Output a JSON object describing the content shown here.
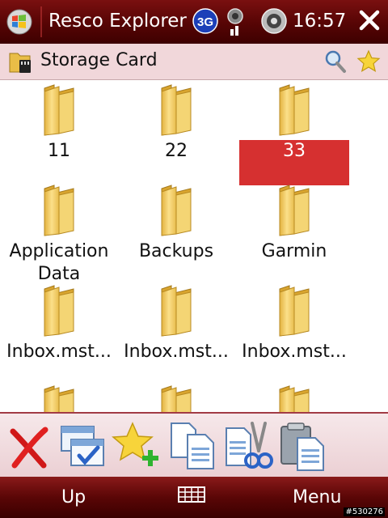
{
  "titlebar": {
    "app_title": "Resco Explorer",
    "network_badge": "3G",
    "time": "16:57",
    "icons": [
      "windows-logo-icon",
      "3g-icon",
      "signal-icon",
      "volume-icon",
      "close-icon"
    ]
  },
  "pathbar": {
    "path": "Storage Card"
  },
  "items": [
    {
      "label": "11",
      "selected": false
    },
    {
      "label": "22",
      "selected": false
    },
    {
      "label": "33",
      "selected": true
    },
    {
      "label": "Application Data",
      "line1": "Application",
      "line2": "Data",
      "selected": false
    },
    {
      "label": "Backups",
      "selected": false
    },
    {
      "label": "Garmin",
      "selected": false
    },
    {
      "label": "Inbox.mst...",
      "selected": false
    },
    {
      "label": "Inbox.mst...",
      "selected": false
    },
    {
      "label": "Inbox.mst...",
      "selected": false
    }
  ],
  "toolbar": {
    "buttons": [
      "delete-icon",
      "multi-select-icon",
      "add-favorite-icon",
      "copy-icon",
      "cut-icon",
      "paste-icon"
    ]
  },
  "softkeys": {
    "left": "Up",
    "right": "Menu"
  },
  "watermark": "#530276",
  "colors": {
    "titlebar": "#5c0606",
    "selection": "#d63030",
    "folder": "#f3cd5c"
  }
}
